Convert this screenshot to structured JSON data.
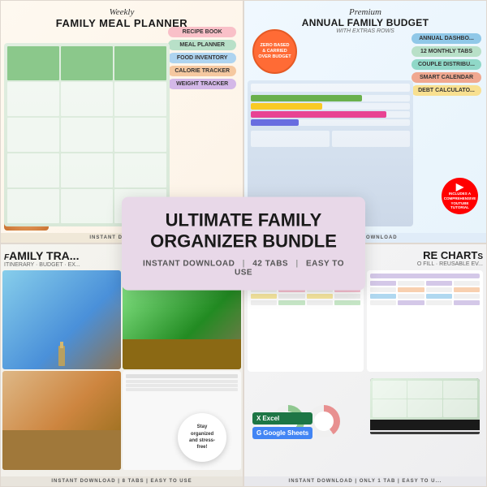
{
  "quadrants": {
    "q1": {
      "weekly_label": "Weekly",
      "title": "FAMILY MEAL PLANNER",
      "tags": [
        {
          "label": "RECIPE BOOK",
          "class": "tag-pink"
        },
        {
          "label": "MEAL PLANNER",
          "class": "tag-green"
        },
        {
          "label": "FOOD INVENTORY",
          "class": "tag-blue"
        },
        {
          "label": "CALORIE TRACKER",
          "class": "tag-peach"
        },
        {
          "label": "WEIGHT TRACKER",
          "class": "tag-lavender"
        }
      ],
      "footer": "INSTANT DOWNLOAD"
    },
    "q2": {
      "premium_label": "Premium",
      "title": "ANNUAL FAMILY BUDGET",
      "subtitle": "WITH EXTRAS ROWS",
      "badge": "ZERO BASED\n& CARRIED\nOVER BUDGET",
      "tags": [
        {
          "label": "ANNUAL DASHBO...",
          "class": "tag-blue2"
        },
        {
          "label": "12 MONTHLY TABS",
          "class": "tag-green"
        },
        {
          "label": "COUPLE DISTRIBU...",
          "class": "tag-teal"
        },
        {
          "label": "SMART CALENDAR",
          "class": "tag-coral"
        },
        {
          "label": "DEBT CALCULATO...",
          "class": "tag-yellow"
        }
      ],
      "footer": "INSTANT DOWNLOAD"
    },
    "q3": {
      "title": "AMILY TRA...",
      "subtitle": "ITINERARY · BUDGET · EX...",
      "bubble": "Stay\norganized\nand stress-\nfree!",
      "footer": "INSTANT DOWNLOAD | 8 TABS | EASY TO USE"
    },
    "q4": {
      "title": "RE CHART...",
      "subtitle": "O FILL · REUSABLE EV...",
      "footer": "INSTANT DOWNLOAD | ONLY 1 TAB | EASY TO U..."
    }
  },
  "center": {
    "title": "ULTIMATE FAMILY\nORGANIZER BUNDLE",
    "instant_download": "INSTANT DOWNLOAD",
    "tabs": "42 TABS",
    "easy": "EASY TO USE",
    "divider1": "|",
    "divider2": "|"
  },
  "excel": {
    "excel_label": "Excel",
    "sheets_label": "Google Sheets"
  },
  "youtube": {
    "label": "INCLUDES A COMPREHENSIVE\nYOUTUBE TUTORIAL"
  }
}
